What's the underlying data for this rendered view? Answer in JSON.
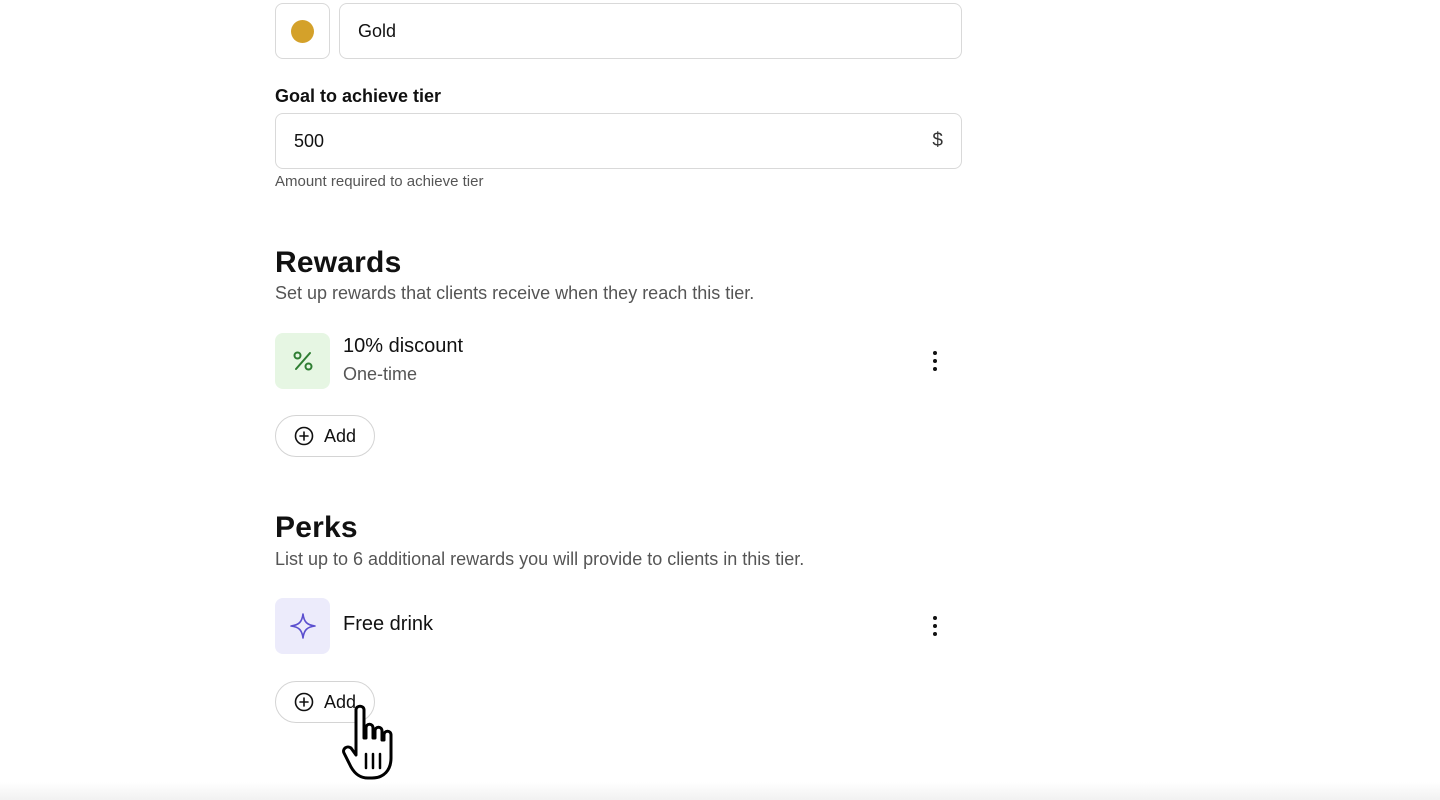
{
  "tier": {
    "color": "#d4a12a",
    "name_value": "Gold"
  },
  "goal": {
    "label": "Goal to achieve tier",
    "value": "500",
    "unit": "$",
    "helper": "Amount required to achieve tier"
  },
  "rewards": {
    "title": "Rewards",
    "subtitle": "Set up rewards that clients receive when they reach this tier.",
    "items": [
      {
        "icon": "percent-icon",
        "title": "10% discount",
        "subtitle": "One-time",
        "icon_bg": "#e6f6e3",
        "icon_color": "#2e7d32"
      }
    ],
    "add_label": "Add"
  },
  "perks": {
    "title": "Perks",
    "subtitle": "List up to 6 additional rewards you will provide to clients in this tier.",
    "items": [
      {
        "icon": "sparkle-icon",
        "title": "Free drink",
        "icon_bg": "#ecebfb",
        "icon_color": "#5b4fcf"
      }
    ],
    "add_label": "Add"
  }
}
